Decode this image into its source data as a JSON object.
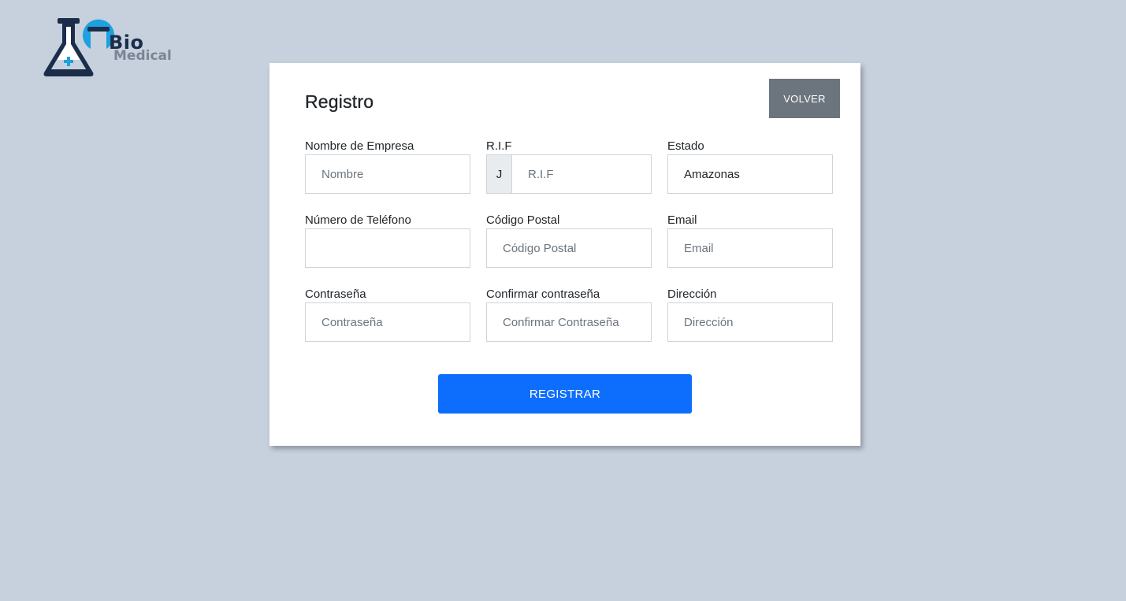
{
  "logo": {
    "text_bio": "Bio",
    "text_medical": "Medical"
  },
  "form": {
    "title": "Registro",
    "back_label": "VOLVER",
    "submit_label": "REGISTRAR",
    "fields": {
      "company_name": {
        "label": "Nombre de Empresa",
        "placeholder": "Nombre",
        "value": ""
      },
      "rif": {
        "label": "R.I.F",
        "prefix": "J",
        "placeholder": "R.I.F",
        "value": ""
      },
      "state": {
        "label": "Estado",
        "placeholder": "",
        "value": "Amazonas"
      },
      "phone": {
        "label": "Número de Teléfono",
        "placeholder": "",
        "value": ""
      },
      "postal_code": {
        "label": "Código Postal",
        "placeholder": "Código Postal",
        "value": ""
      },
      "email": {
        "label": "Email",
        "placeholder": "Email",
        "value": ""
      },
      "password": {
        "label": "Contraseña",
        "placeholder": "Contraseña",
        "value": ""
      },
      "confirm_password": {
        "label": "Confirmar contraseña",
        "placeholder": "Confirmar Contraseña",
        "value": ""
      },
      "address": {
        "label": "Dirección",
        "placeholder": "Dirección",
        "value": ""
      }
    }
  },
  "colors": {
    "background": "#c7d0dd",
    "primary": "#0d6efd",
    "secondary": "#6c757d",
    "logo_dark": "#1a2e4a",
    "logo_accent": "#1da1e0"
  }
}
